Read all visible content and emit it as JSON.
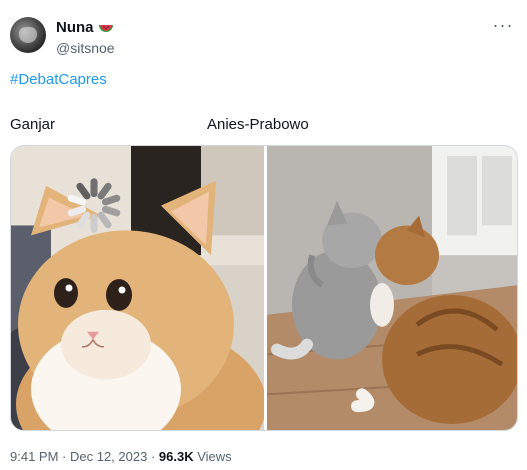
{
  "author": {
    "display_name": "Nuna",
    "emoji_icon": "watermelon-icon",
    "handle": "@sitsnoe"
  },
  "tweet": {
    "hashtag": "#DebatCapres",
    "label_left": "Ganjar",
    "label_right": "Anies-Prabowo"
  },
  "media": {
    "left_image": "orange-kitten-loading-spinner",
    "right_image": "two-cats-hugging"
  },
  "meta": {
    "time": "9:41 PM",
    "separator": " · ",
    "date": "Dec 12, 2023",
    "views_count": "96.3K",
    "views_label": " Views"
  },
  "colors": {
    "link": "#1d9bf0",
    "secondary_text": "#536471"
  }
}
